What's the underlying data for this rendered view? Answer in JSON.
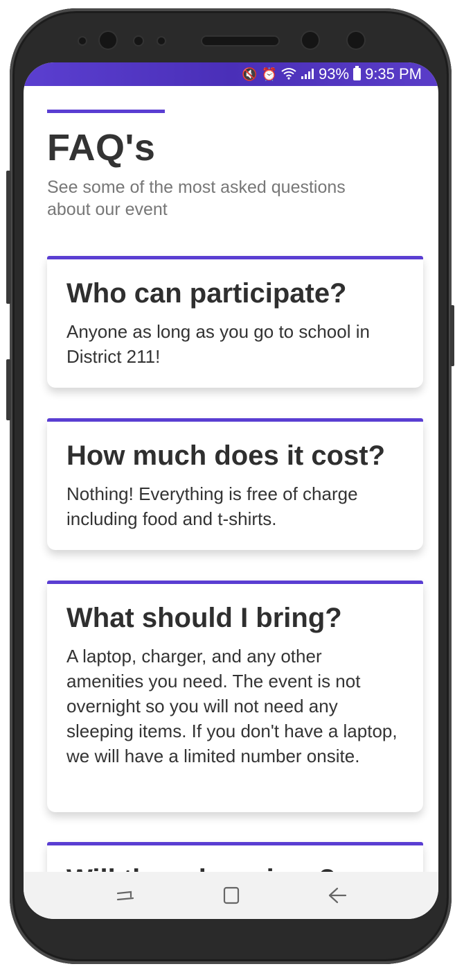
{
  "status_bar": {
    "icons": [
      "mute-vibrate-icon",
      "alarm-icon",
      "wifi-icon",
      "signal-icon",
      "battery-icon"
    ],
    "battery": "93%",
    "time": "9:35 PM",
    "color": "#5a3ed2"
  },
  "header": {
    "title": "FAQ's",
    "subtitle": "See some of the most asked questions about our event",
    "accent_color": "#5a3ed2"
  },
  "faqs": [
    {
      "question": "Who can participate?",
      "answer": "Anyone as long as you go to school in District 211!"
    },
    {
      "question": "How much does it cost?",
      "answer": "Nothing! Everything is free of charge including food and t-shirts."
    },
    {
      "question": "What should I bring?",
      "answer": "A laptop, charger, and any other amenities you need. The event is not overnight so you will not need any sleeping items. If you don't have a laptop, we will have a limited number onsite."
    },
    {
      "question": "Will there be prizes?",
      "answer": ""
    }
  ],
  "nav_bar": {
    "buttons": [
      "recent-apps-icon",
      "home-icon",
      "back-icon"
    ]
  }
}
